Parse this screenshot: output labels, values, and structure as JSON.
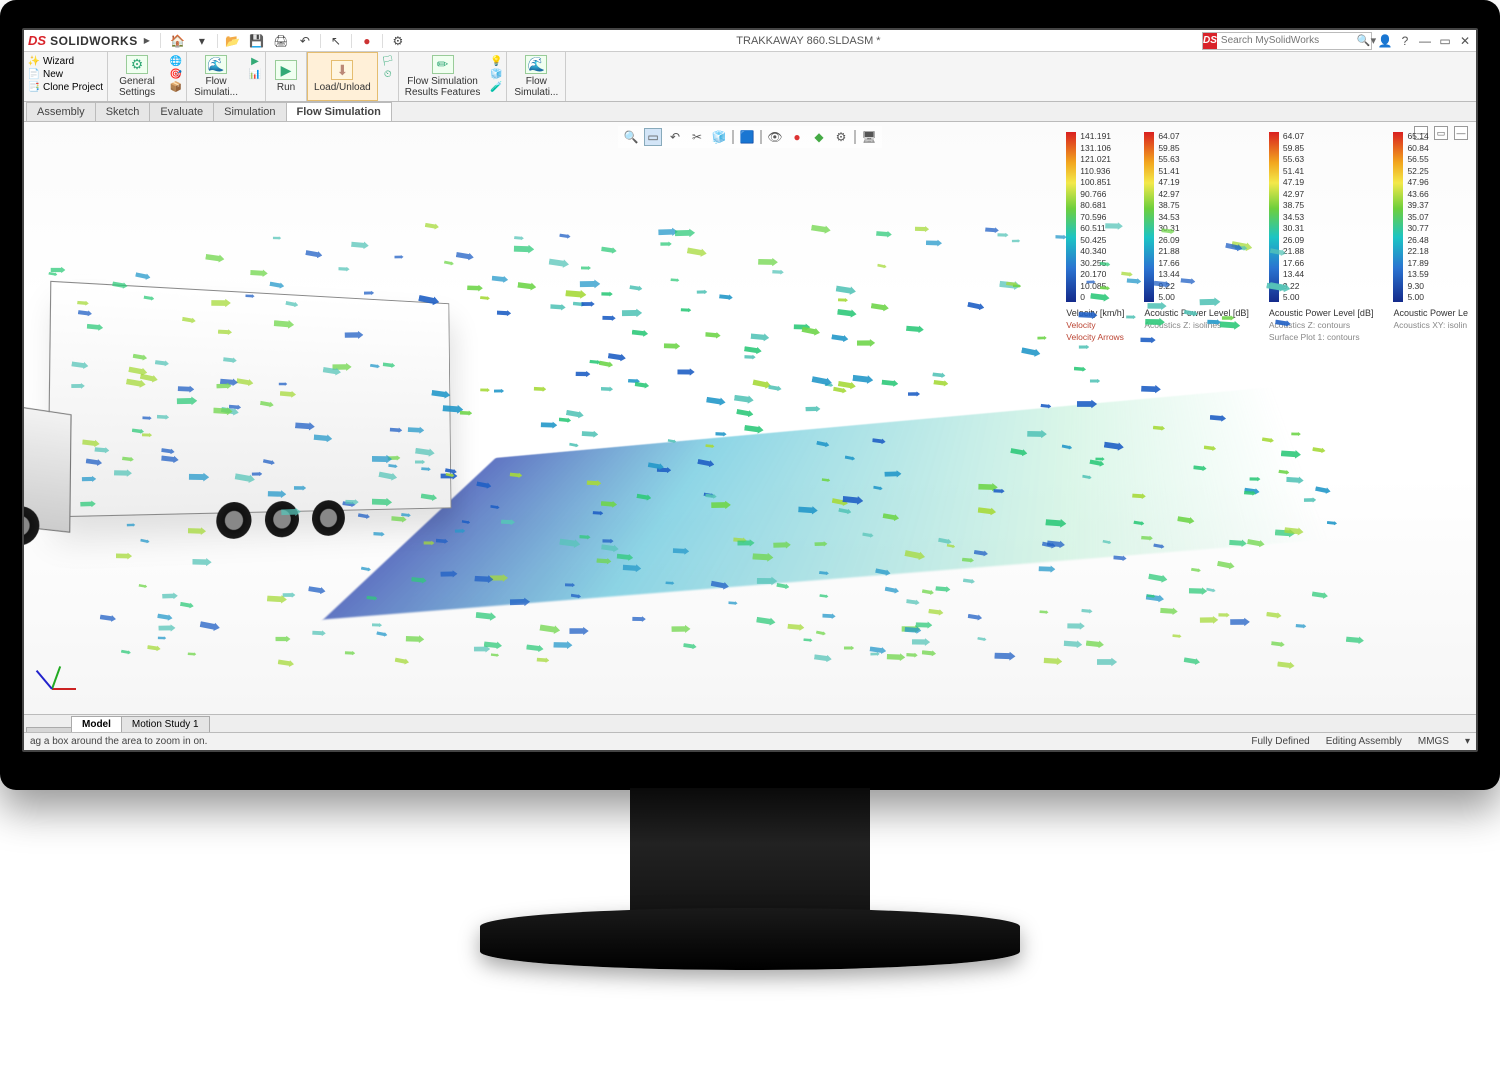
{
  "brand": "SOLIDWORKS",
  "document_title": "TRAKKAWAY 860.SLDASM *",
  "search_placeholder": "Search MySolidWorks",
  "side_panel": {
    "wizard": "Wizard",
    "new": "New",
    "clone": "Clone Project"
  },
  "ribbon": {
    "general_settings": "General\nSettings",
    "flow_simulati1": "Flow\nSimulati...",
    "run": "Run",
    "load_unload": "Load/Unload",
    "flow_results": "Flow Simulation\nResults Features",
    "flow_simulati2": "Flow\nSimulati..."
  },
  "tabs": [
    "Assembly",
    "Sketch",
    "Evaluate",
    "Simulation",
    "Flow Simulation"
  ],
  "active_tab": "Flow Simulation",
  "bottom_tabs": [
    "Model",
    "Motion Study 1"
  ],
  "active_bottom_tab": "Model",
  "status_hint": "ag a box around the area to zoom in on.",
  "status_right": [
    "Fully Defined",
    "Editing Assembly",
    "MMGS"
  ],
  "legends": [
    {
      "title": "Velocity [km/h]",
      "sub1": "Velocity",
      "sub2": "Velocity Arrows",
      "values": [
        "141.191",
        "131.106",
        "121.021",
        "110.936",
        "100.851",
        "90.766",
        "80.681",
        "70.596",
        "60.511",
        "50.425",
        "40.340",
        "30.255",
        "20.170",
        "10.085",
        "0"
      ]
    },
    {
      "title": "Acoustic Power Level [dB]",
      "sub1": "Acoustics Z: isolines",
      "values": [
        "64.07",
        "59.85",
        "55.63",
        "51.41",
        "47.19",
        "42.97",
        "38.75",
        "34.53",
        "30.31",
        "26.09",
        "21.88",
        "17.66",
        "13.44",
        "9.22",
        "5.00"
      ]
    },
    {
      "title": "Acoustic Power Level [dB]",
      "sub1": "Acoustics Z: contours",
      "sub2": "Surface Plot 1: contours",
      "values": [
        "64.07",
        "59.85",
        "55.63",
        "51.41",
        "47.19",
        "42.97",
        "38.75",
        "34.53",
        "30.31",
        "26.09",
        "21.88",
        "17.66",
        "13.44",
        "9.22",
        "5.00"
      ]
    },
    {
      "title": "Acoustic Power Le",
      "sub1": "Acoustics XY: isolin",
      "values": [
        "65.14",
        "60.84",
        "56.55",
        "52.25",
        "47.96",
        "43.66",
        "39.37",
        "35.07",
        "30.77",
        "26.48",
        "22.18",
        "17.89",
        "13.59",
        "9.30",
        "5.00"
      ]
    }
  ]
}
